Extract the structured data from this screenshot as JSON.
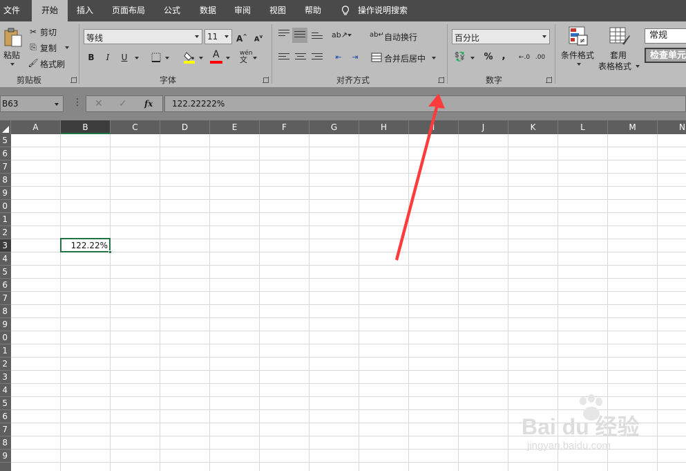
{
  "menu": {
    "tabs": [
      "文件",
      "开始",
      "插入",
      "页面布局",
      "公式",
      "数据",
      "审阅",
      "视图",
      "帮助"
    ],
    "active_tab": "开始",
    "tell_me": "操作说明搜索"
  },
  "ribbon": {
    "clipboard": {
      "paste": "粘贴",
      "cut": "剪切",
      "copy": "复制",
      "format_painter": "格式刷",
      "group_label": "剪贴板"
    },
    "font": {
      "font_name": "等线",
      "font_size": "11",
      "bold": "B",
      "italic": "I",
      "underline": "U",
      "font_color_glyph": "A",
      "phonetic": "wén",
      "group_label": "字体",
      "colors": {
        "highlight": "#ffff00",
        "font": "#ff0000"
      }
    },
    "alignment": {
      "wrap_text": "自动换行",
      "merge_center": "合并后居中",
      "group_label": "对齐方式"
    },
    "number": {
      "format": "百分比",
      "percent": "%",
      "comma": ",",
      "group_label": "数字"
    },
    "styles": {
      "conditional_formatting": "条件格式",
      "format_as_table_line1": "套用",
      "format_as_table_line2": "表格格式",
      "style_normal": "常规",
      "style_check_cell": "检查单元"
    }
  },
  "formula_bar": {
    "name_box": "B63",
    "fx": "fx",
    "value": "122.22222%"
  },
  "grid": {
    "columns": [
      "A",
      "B",
      "C",
      "D",
      "E",
      "F",
      "G",
      "H",
      "I",
      "J",
      "K",
      "L",
      "M",
      "N"
    ],
    "selected_column": "B",
    "rows": [
      "5",
      "6",
      "7",
      "8",
      "9",
      "0",
      "1",
      "2",
      "3",
      "4",
      "5",
      "6",
      "7",
      "8",
      "9",
      "0",
      "1",
      "2",
      "3",
      "4",
      "5",
      "6",
      "7",
      "8",
      "9"
    ],
    "selected_row_index": 8,
    "active_cell_value": "122.22%"
  },
  "watermark": {
    "brand": "Bai du 经验",
    "url": "jingyan.baidu.com"
  },
  "colors": {
    "accent": "#217346",
    "arrow": "#ff3b3b",
    "menubar": "#4a4a4a",
    "ribbon": "#bdbdbd"
  }
}
